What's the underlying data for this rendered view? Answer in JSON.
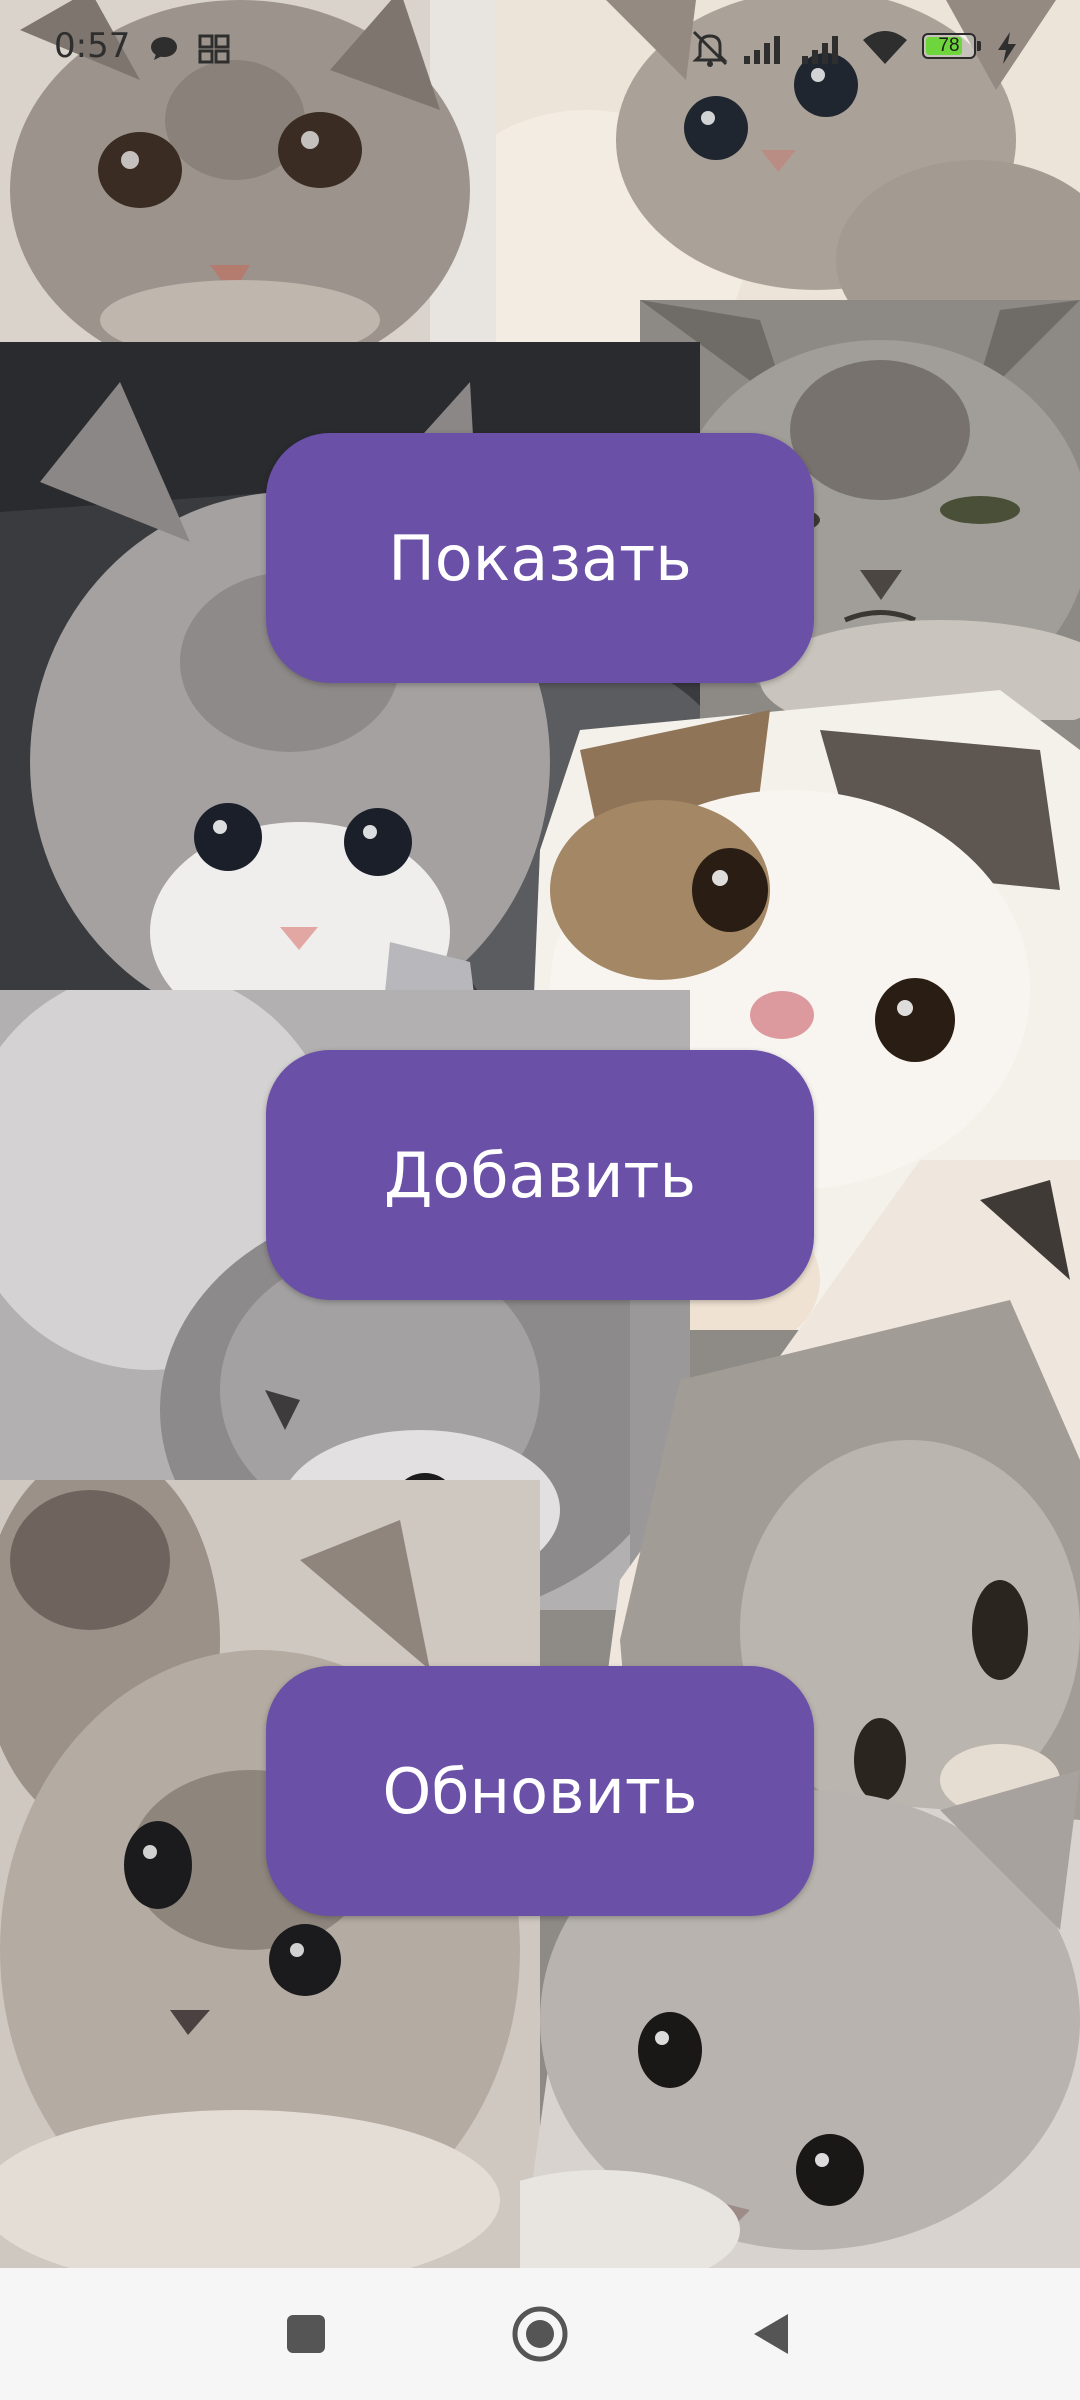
{
  "status_bar": {
    "time": "0:57",
    "battery_level": "78",
    "battery_fraction": 0.78,
    "icons": [
      "chat-bubble-icon",
      "grid-icon",
      "mute-icon",
      "signal-icon",
      "signal-icon",
      "wifi-icon",
      "battery-icon",
      "charging-icon"
    ]
  },
  "main": {
    "show_label": "Показать",
    "add_label": "Добавить",
    "refresh_label": "Обновить",
    "button_color": "#6a50a7"
  },
  "nav_bar": {
    "icons": [
      "recents-icon",
      "home-icon",
      "back-icon"
    ]
  }
}
